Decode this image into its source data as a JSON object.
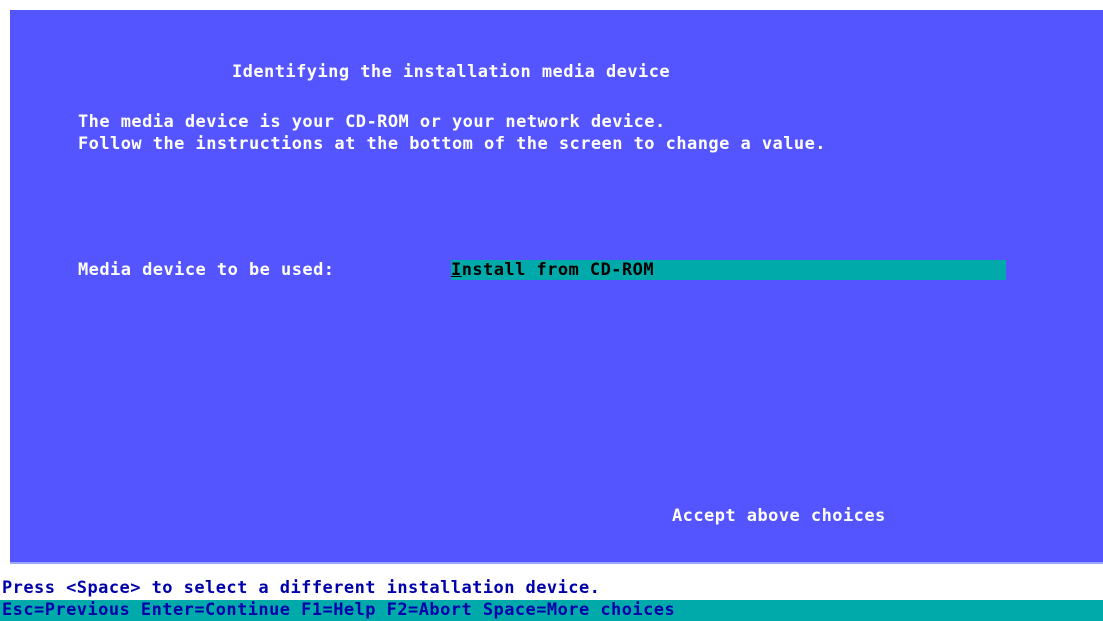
{
  "screen": {
    "title": "Identifying the installation media device",
    "description_line1": "The media device is your CD-ROM or your network device.",
    "description_line2": "Follow the instructions at the bottom of the screen to change a value.",
    "field": {
      "label": "Media device to be used:",
      "value_first_char": "I",
      "value_rest": "nstall from CD-ROM"
    },
    "accept_label": "Accept above choices"
  },
  "status_bar": {
    "hint": "Press <Space> to select a different installation device.",
    "keys": "Esc=Previous Enter=Continue F1=Help F2=Abort Space=More choices"
  },
  "colors": {
    "panel_background": "#5555ff",
    "field_highlight": "#00aaaa",
    "text_white": "#ffffff",
    "status_text": "#0000aa"
  }
}
